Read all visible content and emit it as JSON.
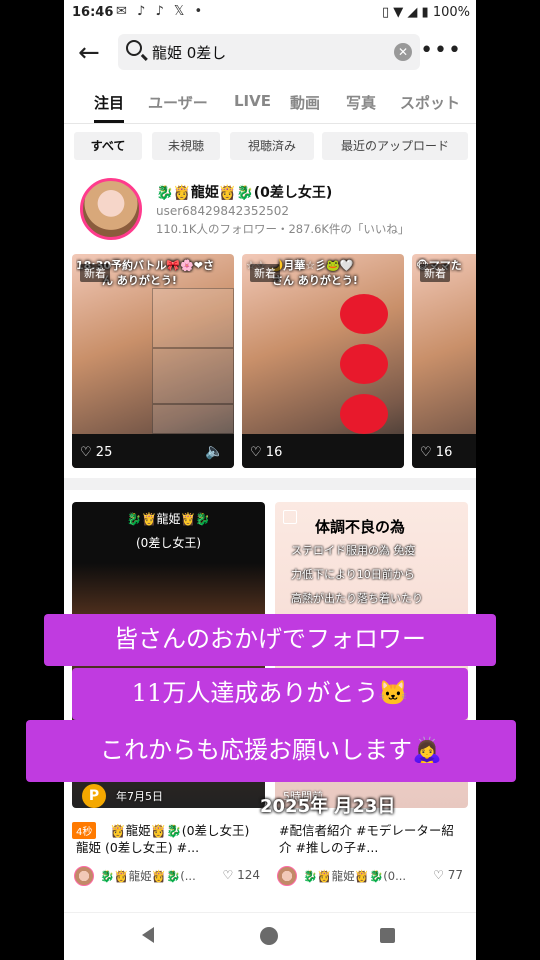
{
  "status": {
    "time": "16:46",
    "battery": "100%",
    "icons": "✉ ♪ ♪ 𝕏 •"
  },
  "search": {
    "query": "龍姫 0差し",
    "more_icon": "more-icon"
  },
  "tabs": [
    "注目",
    "ユーザー",
    "LIVE",
    "動画",
    "写真",
    "スポット"
  ],
  "chips": [
    "すべて",
    "未視聴",
    "視聴済み",
    "最近のアップロード"
  ],
  "user": {
    "name": "🐉👸龍姫👸🐉(0差し女王)",
    "id": "user68429842352502",
    "stats": "110.1K人のフォロワー・287.6K件の「いいね」"
  },
  "thumbs": [
    {
      "caption": "18:30予約バトル🎀🌸❤さ",
      "caption2": "ん ありがとう!",
      "badge": "新着",
      "likes": "25",
      "volume": "🔈"
    },
    {
      "caption": "☆☆ 🌙月華☆彡🐸🤍",
      "caption2": "さん ありがとう!",
      "badge": "新着",
      "likes": "16",
      "volume": ""
    },
    {
      "caption": "🐵ママた",
      "caption2": "",
      "badge": "新着",
      "likes": "16",
      "volume": ""
    }
  ],
  "cards": [
    {
      "title_line1": "🐉👸龍姫👸🐉",
      "title_line2": "(0差し女王)",
      "date": "年7月5日",
      "coin": "P",
      "time_badge": "4秒",
      "desc": "👸龍姫👸🐉(0差し女王) 龍姫 (0差し女王) #...",
      "author": "🐉👸龍姫👸🐉(...",
      "likes": "124"
    },
    {
      "title_line1": "体調不良の為",
      "title_line2": "ステロイド服用の為 免疫",
      "title_line3": "力低下により10日前から",
      "title_line4": "高熱が出たり落ち着いたり",
      "date": "5時間前",
      "desc": "#配信者紹介 #モデレーター紹介 #推しの子#...",
      "author": "🐉👸龍姫👸🐉(0...",
      "likes": "77"
    }
  ],
  "overlay_date": "2025年 月23日",
  "overlay_lines": [
    "皆さんのおかげでフォロワー",
    "11万人達成ありがとう🐱",
    "これからも応援お願いします🙇‍♀️"
  ]
}
